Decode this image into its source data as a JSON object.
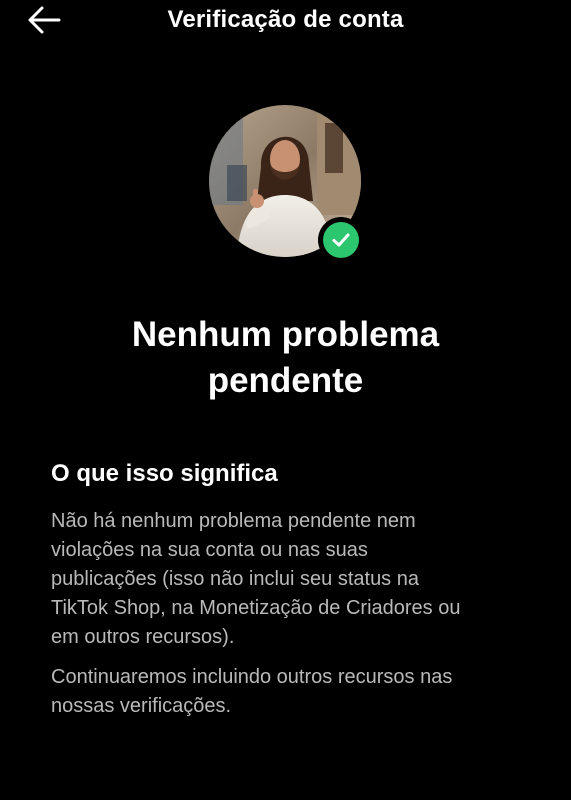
{
  "header": {
    "title": "Verificação de conta",
    "back_icon": "arrow-left-icon"
  },
  "profile": {
    "avatar_icon": "profile-avatar",
    "badge_icon": "check-icon",
    "badge_color": "#2cc66f"
  },
  "status": {
    "headline_line1": "Nenhum problema",
    "headline_line2": "pendente"
  },
  "info": {
    "section_title": "O que isso significa",
    "paragraph_1_lines": [
      "Não há nenhum problema pendente nem",
      "violações na sua conta ou nas suas",
      "publicações (isso não inclui seu status na",
      "TikTok Shop, na Monetização de Criadores ou",
      "em outros recursos)."
    ],
    "paragraph_2_lines": [
      "Continuaremos incluindo outros recursos nas",
      "nossas verificações."
    ]
  },
  "colors": {
    "background": "#000000",
    "text_primary": "#ffffff",
    "text_secondary": "#b9b9b9"
  }
}
